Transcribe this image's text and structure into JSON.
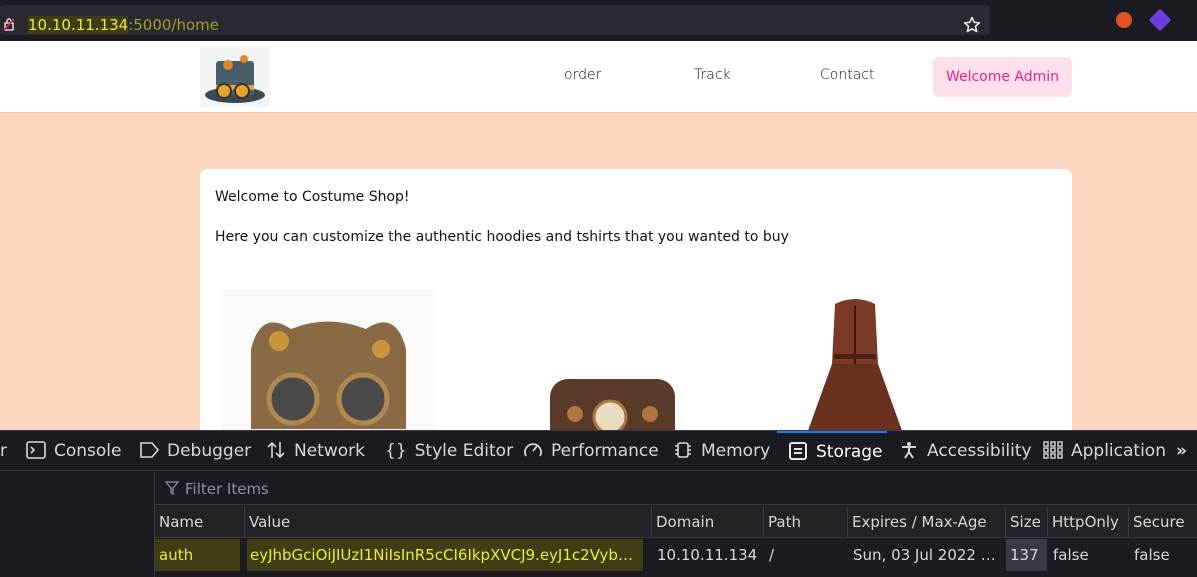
{
  "browser": {
    "url_host": "10.10.11.134",
    "url_path": ":5000/home"
  },
  "site": {
    "nav": {
      "order": "order",
      "track": "Track",
      "contact": "Contact",
      "welcome": "Welcome Admin"
    },
    "card": {
      "title": "Welcome to Costume Shop!",
      "subtitle": "Here you can customize the authentic hoodies and tshirts that you wanted to buy"
    }
  },
  "devtools": {
    "tabs": [
      "Console",
      "Debugger",
      "Network",
      "Style Editor",
      "Performance",
      "Memory",
      "Storage",
      "Accessibility",
      "Application"
    ],
    "active_tab": "Storage",
    "filter_placeholder": "Filter Items",
    "columns": [
      "Name",
      "Value",
      "Domain",
      "Path",
      "Expires / Max-Age",
      "Size",
      "HttpOnly",
      "Secure"
    ],
    "rows": [
      {
        "name": "auth",
        "value": "eyJhbGciOiJIUzI1NiIsInR5cCI6IkpXVCJ9.eyJ1c2VybmFtZ…",
        "domain": "10.10.11.134",
        "path": "/",
        "expires": "Sun, 03 Jul 2022 12:…",
        "size": "137",
        "httponly": "false",
        "secure": "false"
      }
    ]
  }
}
